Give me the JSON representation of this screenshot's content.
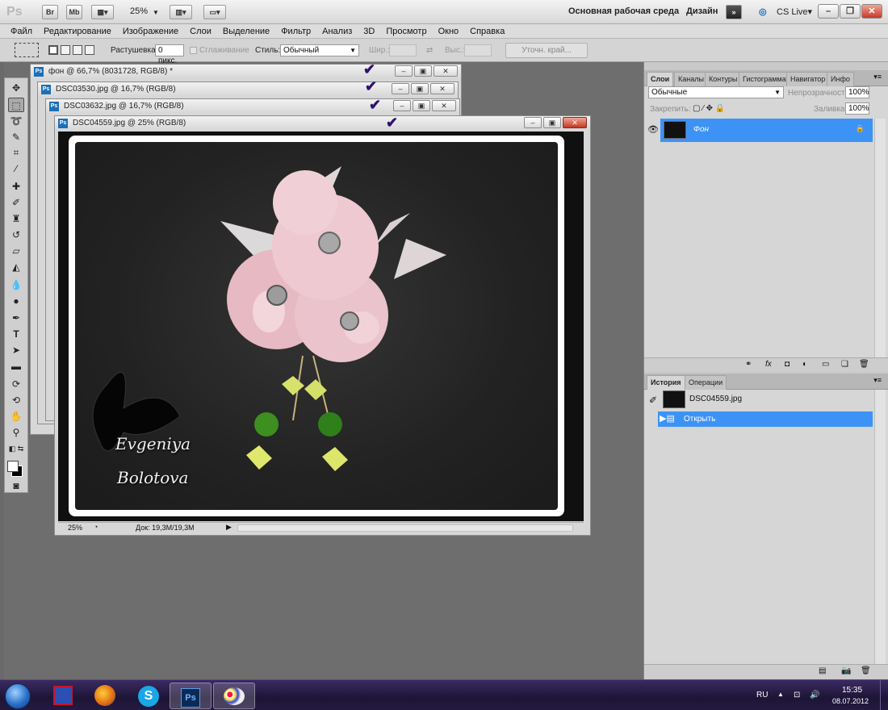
{
  "appbar": {
    "logo": "Ps",
    "br_label": "Br",
    "mb_label": "Mb",
    "zoom": "25%",
    "workspace": "Основная рабочая среда",
    "design": "Дизайн",
    "cs_live": "CS Live"
  },
  "menu": [
    "Файл",
    "Редактирование",
    "Изображение",
    "Слои",
    "Выделение",
    "Фильтр",
    "Анализ",
    "3D",
    "Просмотр",
    "Окно",
    "Справка"
  ],
  "options": {
    "feather_label": "Растушевка:",
    "feather_value": "0 пикс.",
    "antialias_label": "Сглаживание",
    "style_label": "Стиль:",
    "style_value": "Обычный",
    "width_label": "Шир.:",
    "height_label": "Выс.:",
    "refine_edge": "Уточн. край..."
  },
  "documents": [
    {
      "title": "фон @ 66,7% (8031728, RGB/8) *"
    },
    {
      "title": "DSC03530.jpg @ 16,7% (RGB/8)"
    },
    {
      "title": "DSC03632.jpg @ 16,7% (RGB/8)"
    },
    {
      "title": "DSC04559.jpg @ 25% (RGB/8)"
    }
  ],
  "active_doc": {
    "zoom": "25%",
    "doc_size": "Док: 19,3M/19,3M",
    "watermark_line1": "Evgeniya",
    "watermark_line2": "Bolotova"
  },
  "layers_panel": {
    "tabs": [
      "Слои",
      "Каналы",
      "Контуры",
      "Гистограмма",
      "Навигатор",
      "Инфо"
    ],
    "blend_mode": "Обычные",
    "opacity_label": "Непрозрачность:",
    "opacity_value": "100%",
    "lock_label": "Закрепить:",
    "fill_label": "Заливка:",
    "fill_value": "100%",
    "layer_name": "Фон"
  },
  "history_panel": {
    "tabs": [
      "История",
      "Операции"
    ],
    "snapshot": "DSC04559.jpg",
    "step": "Открыть"
  },
  "taskbar": {
    "lang": "RU",
    "time": "15:35",
    "date": "08.07.2012",
    "ps_label": "Ps"
  },
  "colors": {
    "selection_blue": "#3d93f5",
    "check_purple": "#32106d",
    "taskbar": "#1d1536"
  }
}
